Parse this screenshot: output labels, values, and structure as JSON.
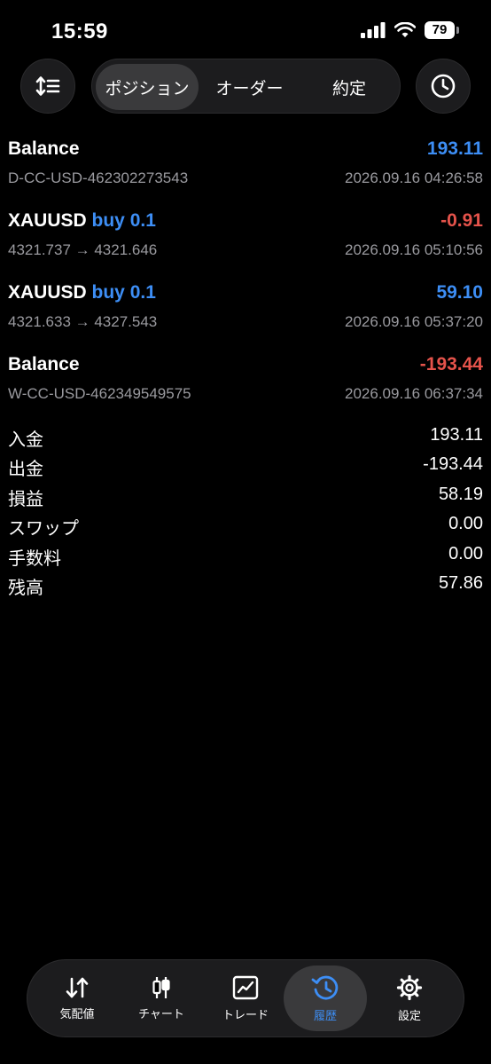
{
  "status_bar": {
    "time": "15:59",
    "battery": "79"
  },
  "toolbar": {
    "tabs": [
      {
        "label": "ポジション",
        "active": true
      },
      {
        "label": "オーダー",
        "active": false
      },
      {
        "label": "約定",
        "active": false
      }
    ]
  },
  "history": [
    {
      "title": "Balance",
      "type": "",
      "amount": "193.11",
      "sign": "positive",
      "sub": "D-CC-USD-462302273543",
      "time": "2026.09.16 04:26:58"
    },
    {
      "title": "XAUUSD",
      "type": "buy 0.1",
      "amount": "-0.91",
      "sign": "negative",
      "sub": "4321.737 → 4321.646",
      "time": "2026.09.16 05:10:56"
    },
    {
      "title": "XAUUSD",
      "type": "buy 0.1",
      "amount": "59.10",
      "sign": "positive",
      "sub": "4321.633 → 4327.543",
      "time": "2026.09.16 05:37:20"
    },
    {
      "title": "Balance",
      "type": "",
      "amount": "-193.44",
      "sign": "negative",
      "sub": "W-CC-USD-462349549575",
      "time": "2026.09.16 06:37:34"
    }
  ],
  "summary": [
    {
      "label": "入金",
      "value": "193.11"
    },
    {
      "label": "出金",
      "value": "-193.44"
    },
    {
      "label": "損益",
      "value": "58.19"
    },
    {
      "label": "スワップ",
      "value": "0.00"
    },
    {
      "label": "手数料",
      "value": "0.00"
    },
    {
      "label": "残高",
      "value": "57.86"
    }
  ],
  "bottom_nav": [
    {
      "label": "気配値",
      "icon": "quotes-arrows-icon",
      "active": false
    },
    {
      "label": "チャート",
      "icon": "candlestick-chart-icon",
      "active": false
    },
    {
      "label": "トレード",
      "icon": "trade-chart-icon",
      "active": false
    },
    {
      "label": "履歴",
      "icon": "history-clock-icon",
      "active": true
    },
    {
      "label": "設定",
      "icon": "gear-icon",
      "active": false
    }
  ],
  "colors": {
    "positive": "#3d8ef5",
    "negative": "#e5534b",
    "accent": "#3d8ef5",
    "background": "#000000"
  }
}
